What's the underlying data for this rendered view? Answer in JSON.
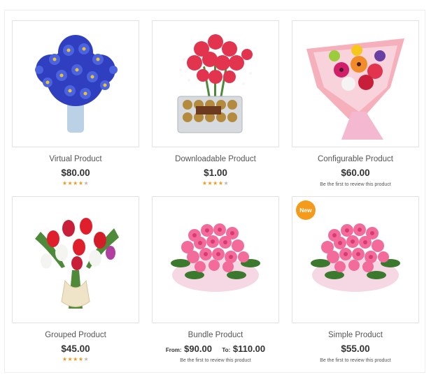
{
  "products": [
    {
      "name": "Virtual Product",
      "price": "$80.00",
      "rating": 3.5,
      "image": "blue-daisy-bouquet-image"
    },
    {
      "name": "Downloadable Product",
      "price": "$1.00",
      "rating": 4,
      "image": "carnations-with-chocolates-image"
    },
    {
      "name": "Configurable Product",
      "price": "$60.00",
      "review_text": "Be the first to review this product",
      "image": "mixed-flower-bouquet-image"
    },
    {
      "name": "Grouped Product",
      "price": "$45.00",
      "rating": 3.5,
      "image": "tulip-bouquet-image"
    },
    {
      "name": "Bundle Product",
      "from_label": "From:",
      "from_price": "$90.00",
      "to_label": "To:",
      "to_price": "$110.00",
      "review_text": "Be the first to review this product",
      "image": "pink-roses-image"
    },
    {
      "name": "Simple Product",
      "price": "$55.00",
      "review_text": "Be the first to review this product",
      "badge": "New",
      "image": "pink-roses-image"
    }
  ],
  "colors": {
    "accent": "#f49b1b",
    "star_on": "#ef9a1d",
    "star_off": "#b8b8b8",
    "border": "#e2e2e2"
  }
}
